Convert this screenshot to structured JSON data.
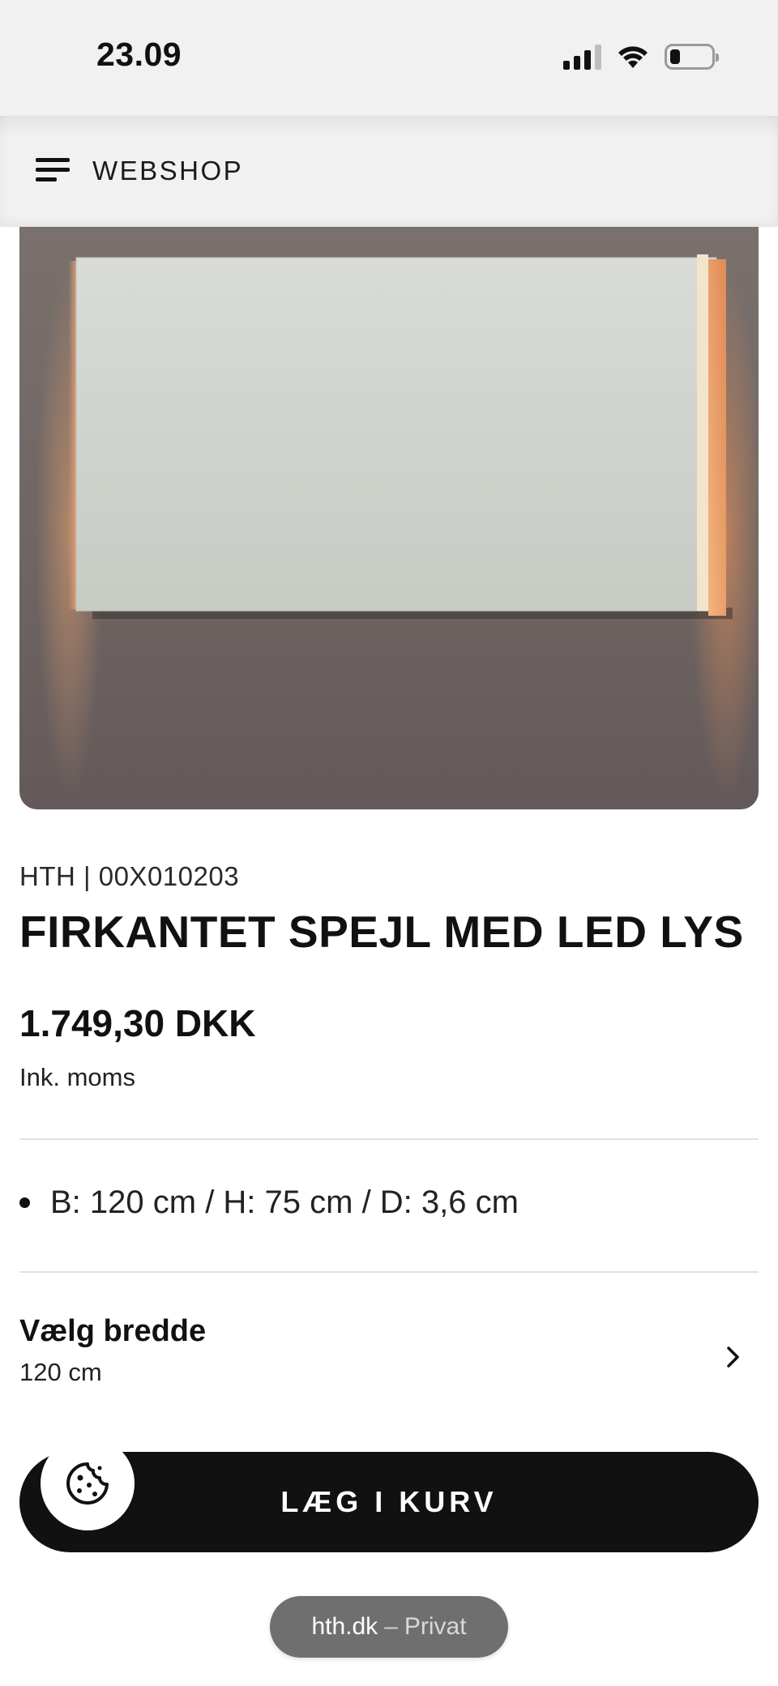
{
  "status_bar": {
    "time": "23.09"
  },
  "nav": {
    "title": "WEBSHOP"
  },
  "product": {
    "sku": "HTH | 00X010203",
    "title": "FIRKANTET SPEJL MED LED LYS",
    "price": "1.749,30 DKK",
    "vat_note": "Ink. moms",
    "specs": [
      "B: 120 cm / H: 75 cm / D: 3,6 cm"
    ],
    "width_selector": {
      "label": "Vælg bredde",
      "value": "120 cm"
    }
  },
  "cta": {
    "add_to_cart_label": "LÆG I KURV"
  },
  "browser": {
    "domain": "hth.dk",
    "separator": "–",
    "mode": "Privat"
  },
  "colors": {
    "accent": "#111111",
    "background": "#ffffff",
    "bar": "#f1f1f1"
  }
}
